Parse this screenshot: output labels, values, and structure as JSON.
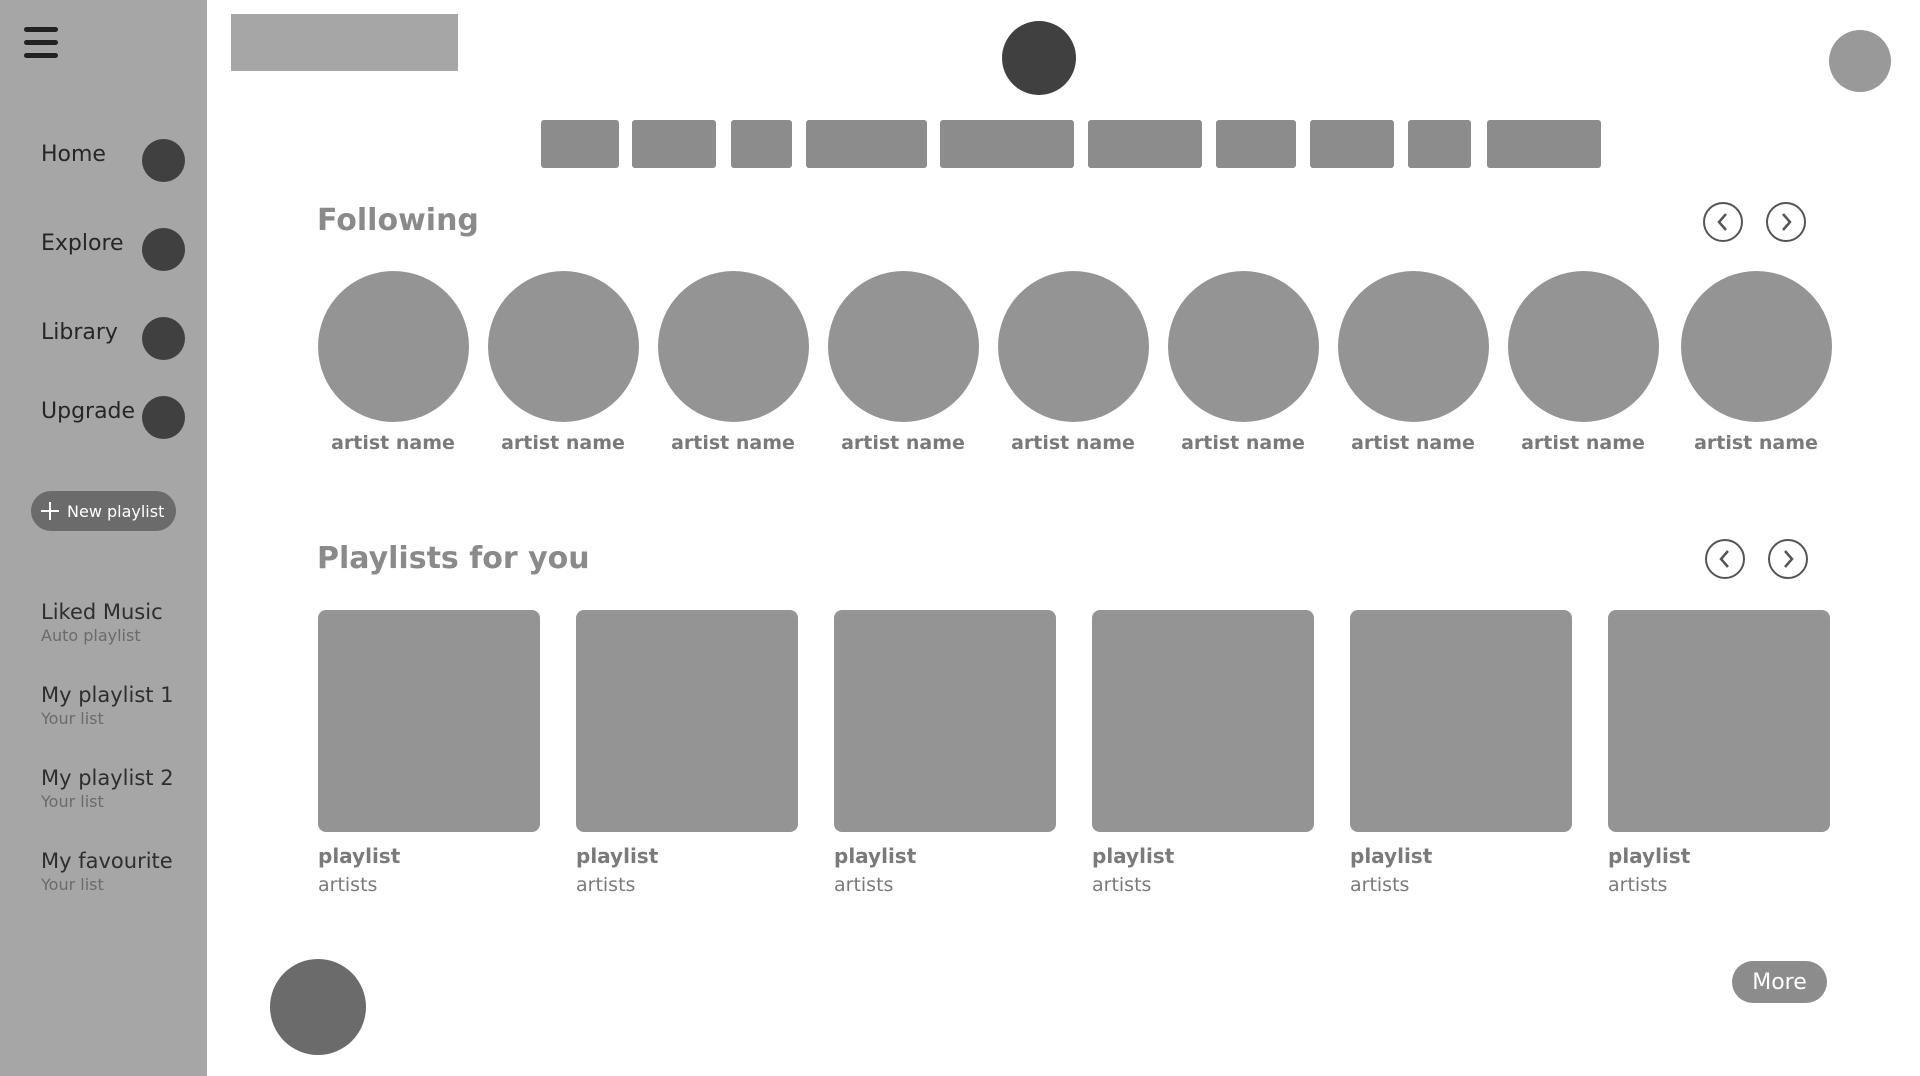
{
  "sidebar": {
    "menu_icon": "hamburger-menu-icon",
    "nav": [
      {
        "label": "Home"
      },
      {
        "label": "Explore"
      },
      {
        "label": "Library"
      },
      {
        "label": "Upgrade"
      }
    ],
    "new_playlist_label": "New playlist",
    "playlists": [
      {
        "title": "Liked Music",
        "subtitle": "Auto playlist"
      },
      {
        "title": "My playlist 1",
        "subtitle": "Your list"
      },
      {
        "title": "My playlist 2",
        "subtitle": "Your list"
      },
      {
        "title": "My favourite",
        "subtitle": "Your list"
      }
    ]
  },
  "following": {
    "title": "Following",
    "artists": [
      {
        "name": "artist name"
      },
      {
        "name": "artist name"
      },
      {
        "name": "artist name"
      },
      {
        "name": "artist name"
      },
      {
        "name": "artist name"
      },
      {
        "name": "artist name"
      },
      {
        "name": "artist name"
      },
      {
        "name": "artist name"
      },
      {
        "name": "artist name"
      }
    ]
  },
  "playlists_for_you": {
    "title": "Playlists for you",
    "items": [
      {
        "title": "playlist",
        "subtitle": "artists"
      },
      {
        "title": "playlist",
        "subtitle": "artists"
      },
      {
        "title": "playlist",
        "subtitle": "artists"
      },
      {
        "title": "playlist",
        "subtitle": "artists"
      },
      {
        "title": "playlist",
        "subtitle": "artists"
      },
      {
        "title": "playlist",
        "subtitle": "artists"
      }
    ]
  },
  "more_label": "More",
  "colors": {
    "sidebar_bg": "#a6a6a6",
    "placeholder": "#949494",
    "dark_dot": "#404040"
  }
}
